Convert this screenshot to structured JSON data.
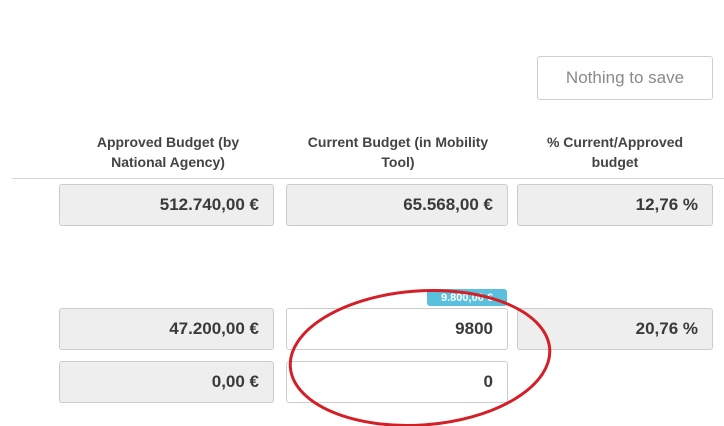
{
  "save_button": {
    "label": "Nothing to save"
  },
  "columns": {
    "approved": {
      "line1": "Approved Budget (by",
      "line2": "National Agency)"
    },
    "current": {
      "line1": "Current Budget (in Mobility",
      "line2": "Tool)"
    },
    "percent": {
      "line1": "% Current/Approved",
      "line2": "budget"
    }
  },
  "rows": {
    "total": {
      "approved": "512.740,00 €",
      "current": "65.568,00 €",
      "percent": "12,76 %"
    },
    "row2": {
      "badge": "9.800,00 €",
      "approved": "47.200,00 €",
      "current": "9800",
      "percent": "20,76 %"
    },
    "row3": {
      "approved": "0,00 €",
      "current": "0"
    }
  },
  "annotation": {
    "color": "#d32028"
  },
  "colors": {
    "badge": "#5bc0de",
    "readonly_bg": "#eeeeee"
  }
}
